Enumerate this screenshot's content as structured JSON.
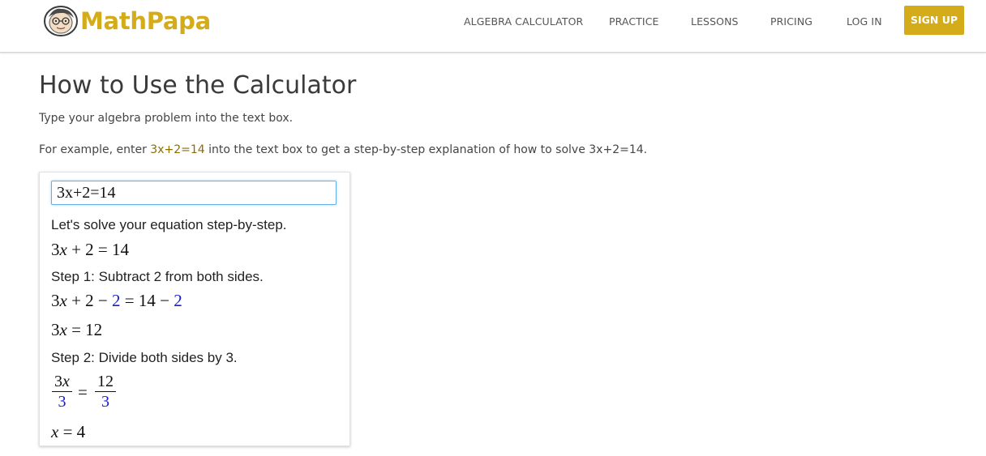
{
  "brand": {
    "name": "MathPapa",
    "color": "#d4ac19"
  },
  "nav": {
    "items": [
      {
        "label": "ALGEBRA CALCULATOR"
      },
      {
        "label": "PRACTICE"
      },
      {
        "label": "LESSONS"
      },
      {
        "label": "PRICING"
      },
      {
        "label": "LOG IN"
      }
    ],
    "signup_label": "SIGN UP"
  },
  "main": {
    "title": "How to Use the Calculator",
    "intro_1": "Type your algebra problem into the text box.",
    "intro_2_prefix": "For example, enter ",
    "intro_2_example": "3x+2=14",
    "intro_2_suffix": " into the text box to get a step-by-step explanation of how to solve 3x+2=14."
  },
  "calculator": {
    "input_value": "3x+2=14",
    "intro_text": "Let's solve your equation step-by-step.",
    "equation": "3x + 2 = 14",
    "step1_text": "Step 1: Subtract 2 from both sides.",
    "step1_equation": "3x + 2 − 2 = 14 − 2",
    "step1_result": "3x = 12",
    "step2_text": "Step 2: Divide both sides by 3.",
    "step2_fraction": {
      "left_num": "3x",
      "left_den": "3",
      "right_num": "12",
      "right_den": "3"
    },
    "answer": "x = 4",
    "highlight_color": "#1a1ad6"
  }
}
